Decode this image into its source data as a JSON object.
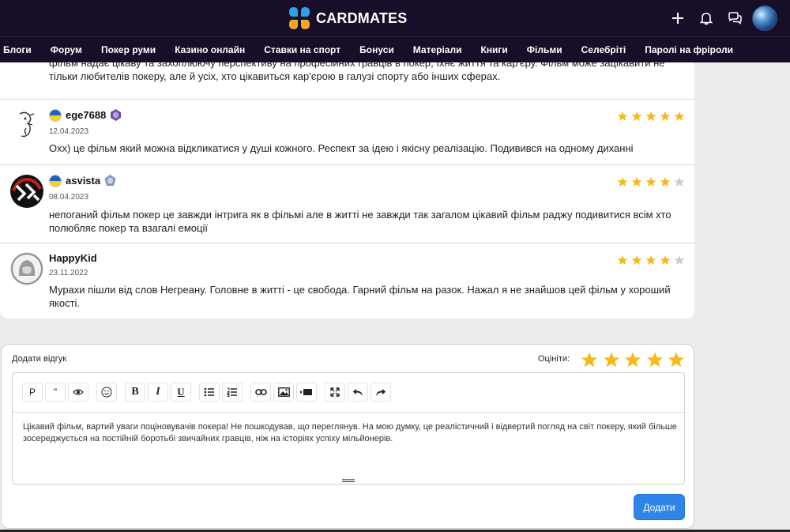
{
  "header": {
    "logo_text": "CARDMATES",
    "icons": [
      "plus-icon",
      "bell-icon",
      "chat-icon",
      "user-avatar"
    ]
  },
  "nav": {
    "items": [
      "Блоги",
      "Форум",
      "Покер руми",
      "Казино онлайн",
      "Ставки на спорт",
      "Бонуси",
      "Матеріали",
      "Книги",
      "Фільми",
      "Селебріті",
      "Паролі на фріроли"
    ]
  },
  "reviews": {
    "continuation_text": "фільм надає цікаву та захоплюючу перспективу на професійних гравців в покер, їхнє життя та кар'єру. Фільм може зацікавити не тільки любителів покеру, але й усіх, хто цікавиться кар'єрою в галузі спорту або інших сферах.",
    "items": [
      {
        "name": "ege7688",
        "date": "12.04.2023",
        "rating": 5,
        "flag": "ukraine",
        "text": "Охх) це фільм який можна відкликатися у душі кожного. Респект за ідею і якісну реалізацію. Подивився на одному диханні"
      },
      {
        "name": "asvista",
        "date": "08.04.2023",
        "rating": 4,
        "flag": "ukraine",
        "text": "непоганий фільм покер це завжди інтрига як в фільмі але в житті не завжди так загалом цікавий фільм раджу подивитися всім хто полюбляє покер та взагалі емоції"
      },
      {
        "name": "HappyKid",
        "date": "23.11.2022",
        "rating": 4,
        "text": "Мурахи пішли від слов Негреану. Головне в житті - це свобода. Гарний фільм на разок. Нажал я не знайшов цей фільм у хороший якості."
      }
    ]
  },
  "review_form": {
    "title": "Додати відгук",
    "rate_label": "Оцініти:",
    "toolbar_p": "P",
    "toolbar_quote": "\"",
    "toolbar_bold": "B",
    "toolbar_italic": "I",
    "toolbar_underline": "U",
    "editor_text": "Цікавий фільм, вартий уваги поціновувачів покера! Не пошкодував, що переглянув. На мою думку, це реалістичний і відвертий погляд на світ покеру, який більше зосереджується на постійній боротьбі звичайних гравців, ніж на історіях успіху мільйонерів.",
    "submit_label": "Додати"
  },
  "colors": {
    "header_bg": "#170e29",
    "star_gold": "#f5b91a",
    "star_gray": "#cccccc",
    "submit_blue": "#2f84e8"
  }
}
